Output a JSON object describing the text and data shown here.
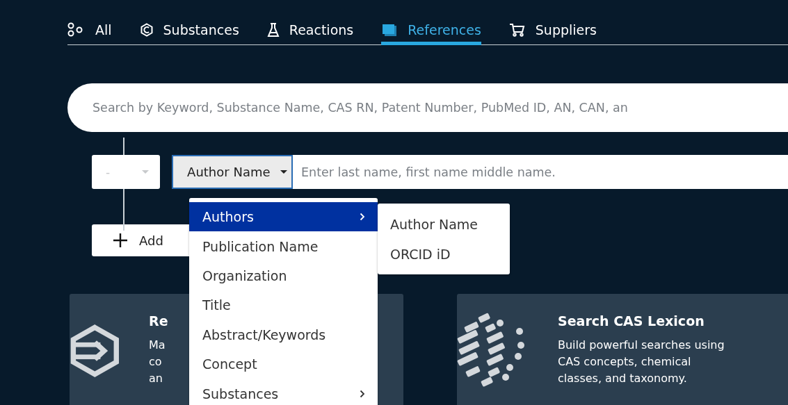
{
  "tabs": [
    {
      "label": "All",
      "kind": "all",
      "selected": false
    },
    {
      "label": "Substances",
      "kind": "substances",
      "selected": false
    },
    {
      "label": "Reactions",
      "kind": "reactions",
      "selected": false
    },
    {
      "label": "References",
      "kind": "references",
      "selected": true
    },
    {
      "label": "Suppliers",
      "kind": "suppliers",
      "selected": false
    }
  ],
  "search": {
    "placeholder": "Search by Keyword, Substance Name, CAS RN, Patent Number, PubMed ID, AN, CAN, an"
  },
  "query_row": {
    "operator": "-",
    "field": "Author Name",
    "placeholder": "Enter last name, first name middle name."
  },
  "add_button": {
    "label": "Add"
  },
  "field_menu": {
    "items": [
      {
        "label": "Authors",
        "selected": true,
        "submenu": true
      },
      {
        "label": "Publication Name",
        "selected": false,
        "submenu": false
      },
      {
        "label": "Organization",
        "selected": false,
        "submenu": false
      },
      {
        "label": "Title",
        "selected": false,
        "submenu": false
      },
      {
        "label": "Abstract/Keywords",
        "selected": false,
        "submenu": false
      },
      {
        "label": "Concept",
        "selected": false,
        "submenu": false
      },
      {
        "label": "Substances",
        "selected": false,
        "submenu": true
      }
    ],
    "submenu": [
      "Author Name",
      "ORCID iD"
    ]
  },
  "cards": [
    {
      "kind": "hex-arrow",
      "title": "Re",
      "lines": [
        "Ma",
        "co",
        "an"
      ]
    },
    {
      "kind": "dots",
      "title": "Search CAS Lexicon",
      "lines": [
        "Build powerful searches using",
        "CAS concepts, chemical",
        "classes, and taxonomy."
      ]
    }
  ]
}
